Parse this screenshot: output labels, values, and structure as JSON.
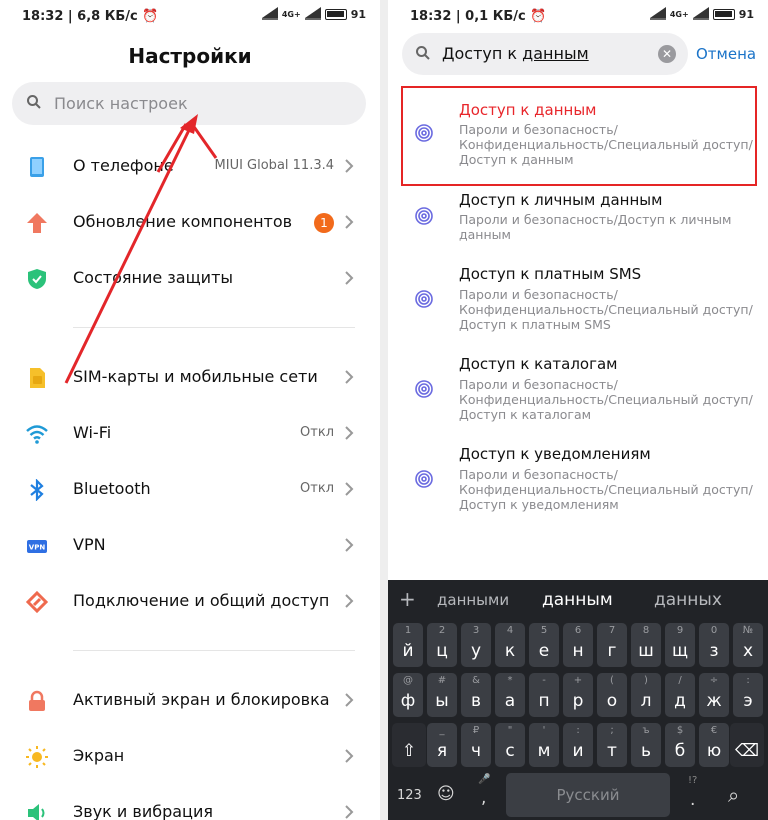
{
  "left": {
    "status": {
      "time": "18:32 | 6,8 КБ/с ⏰",
      "net": "4G+",
      "battery": "91"
    },
    "title": "Настройки",
    "search_placeholder": "Поиск настроек",
    "group1": [
      {
        "label": "О телефоне",
        "value": "MIUI Global 11.3.4",
        "icon": "phone-icon"
      },
      {
        "label": "Обновление компонентов",
        "badge": "1",
        "icon": "update-arrow-icon"
      },
      {
        "label": "Состояние защиты",
        "icon": "shield-icon"
      }
    ],
    "group2": [
      {
        "label": "SIM-карты и мобильные сети",
        "icon": "sim-icon"
      },
      {
        "label": "Wi-Fi",
        "value": "Откл",
        "icon": "wifi-icon"
      },
      {
        "label": "Bluetooth",
        "value": "Откл",
        "icon": "bluetooth-icon"
      },
      {
        "label": "VPN",
        "icon_text": "VPN",
        "icon": "vpn-icon"
      },
      {
        "label": "Подключение и общий доступ",
        "icon": "connection-icon"
      }
    ],
    "group3": [
      {
        "label": "Активный экран и блокировка",
        "icon": "lock-icon"
      },
      {
        "label": "Экран",
        "icon": "sun-icon"
      },
      {
        "label": "Звук и вибрация",
        "icon": "speaker-icon"
      }
    ]
  },
  "right": {
    "status": {
      "time": "18:32 | 0,1 КБ/с ⏰",
      "net": "4G+",
      "battery": "91"
    },
    "search": {
      "text_pre": "Доступ к ",
      "text_u": "данным",
      "clear": "✕"
    },
    "cancel": "Отмена",
    "results": [
      {
        "title": "Доступ к данным",
        "sub": "Пароли и безопасность/ Конфиденциальность/Специальный доступ/ Доступ к данным"
      },
      {
        "title": "Доступ к личным данным",
        "sub": "Пароли и безопасность/Доступ к личным данным"
      },
      {
        "title": "Доступ к платным SMS",
        "sub": "Пароли и безопасность/ Конфиденциальность/Специальный доступ/ Доступ к платным SMS"
      },
      {
        "title": "Доступ к каталогам",
        "sub": "Пароли и безопасность/ Конфиденциальность/Специальный доступ/ Доступ к каталогам"
      },
      {
        "title": "Доступ к уведомлениям",
        "sub": "Пароли и безопасность/ Конфиденциальность/Специальный доступ/ Доступ к уведомлениям"
      }
    ],
    "keyboard": {
      "plus": "+",
      "suggestions": [
        "данными",
        "данным",
        "данных"
      ],
      "row1": {
        "main": [
          "й",
          "ц",
          "у",
          "к",
          "е",
          "н",
          "г",
          "ш",
          "щ",
          "з",
          "х"
        ],
        "hint": [
          "1",
          "2",
          "3",
          "4",
          "5",
          "6",
          "7",
          "8",
          "9",
          "0",
          "№"
        ]
      },
      "row2": {
        "main": [
          "ф",
          "ы",
          "в",
          "а",
          "п",
          "р",
          "о",
          "л",
          "д",
          "ж",
          "э"
        ],
        "hint": [
          "@",
          "#",
          "&",
          "*",
          "-",
          "+",
          "(",
          ")",
          "/",
          "÷",
          ":"
        ]
      },
      "row3": {
        "main": [
          "я",
          "ч",
          "с",
          "м",
          "и",
          "т",
          "ь",
          "б",
          "ю"
        ],
        "hint": [
          "_",
          "₽",
          "\"",
          "'",
          ":",
          ";",
          "ъ",
          "$",
          "€"
        ]
      },
      "shift": "⇧",
      "backspace": "⌫",
      "num": "123",
      "emoji": "☺",
      "mic": "🎤",
      "comma": ",",
      "space": "Русский",
      "period": ".",
      "period_hint": "!?",
      "search": "⌕"
    }
  }
}
